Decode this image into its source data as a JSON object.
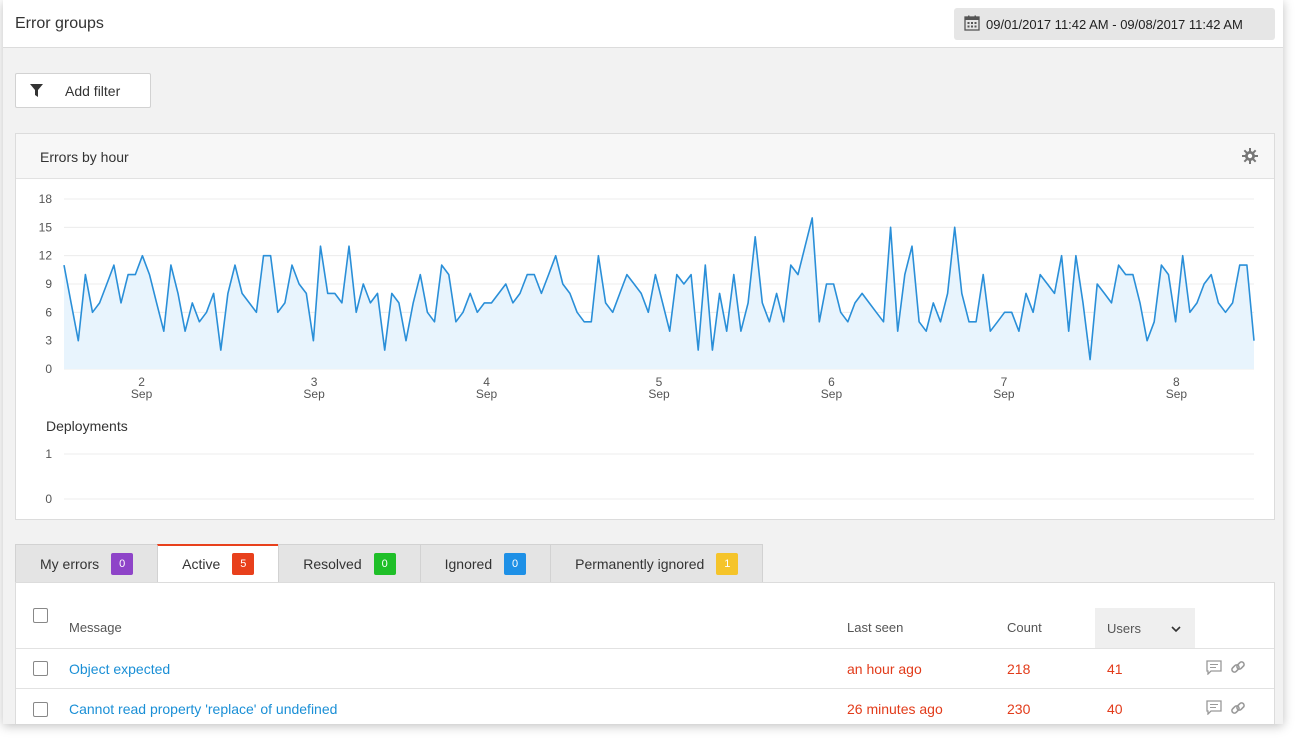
{
  "header": {
    "title": "Error groups",
    "date_range": "09/01/2017 11:42 AM - 09/08/2017 11:42 AM",
    "calendar_icon": "calendar-icon"
  },
  "filter": {
    "label": "Add filter",
    "icon": "filter-icon"
  },
  "chart_panel": {
    "title": "Errors by hour",
    "settings_icon": "gear-icon",
    "deployments_label": "Deployments",
    "deployments_ticks": [
      "1",
      "0"
    ]
  },
  "chart_data": {
    "type": "area",
    "title": "Errors by hour",
    "ylim": [
      0,
      18
    ],
    "yticks": [
      "0",
      "3",
      "6",
      "9",
      "12",
      "15",
      "18"
    ],
    "xticks": [
      {
        "day": "2",
        "month": "Sep"
      },
      {
        "day": "3",
        "month": "Sep"
      },
      {
        "day": "4",
        "month": "Sep"
      },
      {
        "day": "5",
        "month": "Sep"
      },
      {
        "day": "6",
        "month": "Sep"
      },
      {
        "day": "7",
        "month": "Sep"
      },
      {
        "day": "8",
        "month": "Sep"
      }
    ],
    "x_start_day": 1.55,
    "x_end_day": 8.45,
    "color": "#2a8fd8",
    "fill": "#e8f4fd",
    "values": [
      11,
      7,
      3,
      10,
      6,
      7,
      9,
      11,
      7,
      10,
      10,
      12,
      10,
      7,
      4,
      11,
      8,
      4,
      7,
      5,
      6,
      8,
      2,
      8,
      11,
      8,
      7,
      6,
      12,
      12,
      6,
      7,
      11,
      9,
      8,
      3,
      13,
      8,
      8,
      7,
      13,
      6,
      9,
      7,
      8,
      2,
      8,
      7,
      3,
      7,
      10,
      6,
      5,
      11,
      10,
      5,
      6,
      8,
      6,
      7,
      7,
      8,
      9,
      7,
      8,
      10,
      10,
      8,
      10,
      12,
      9,
      8,
      6,
      5,
      5,
      12,
      7,
      6,
      8,
      10,
      9,
      8,
      6,
      10,
      7,
      4,
      10,
      9,
      10,
      2,
      11,
      2,
      8,
      4,
      10,
      4,
      7,
      14,
      7,
      5,
      8,
      5,
      11,
      10,
      13,
      16,
      5,
      9,
      9,
      6,
      5,
      7,
      8,
      7,
      6,
      5,
      15,
      4,
      10,
      13,
      5,
      4,
      7,
      5,
      8,
      15,
      8,
      5,
      5,
      10,
      4,
      5,
      6,
      6,
      4,
      8,
      6,
      10,
      9,
      8,
      12,
      4,
      12,
      7,
      1,
      9,
      8,
      7,
      11,
      10,
      10,
      7,
      3,
      5,
      11,
      10,
      5,
      12,
      6,
      7,
      9,
      10,
      7,
      6,
      7,
      11,
      11,
      3
    ]
  },
  "tabs": [
    {
      "label": "My errors",
      "count": "0",
      "color": "#8e44c8"
    },
    {
      "label": "Active",
      "count": "5",
      "color": "#e8401c"
    },
    {
      "label": "Resolved",
      "count": "0",
      "color": "#1fbf28"
    },
    {
      "label": "Ignored",
      "count": "0",
      "color": "#1e90e6"
    },
    {
      "label": "Permanently ignored",
      "count": "1",
      "color": "#f5c42a"
    }
  ],
  "table": {
    "columns": {
      "message": "Message",
      "last_seen": "Last seen",
      "count": "Count",
      "users": "Users"
    },
    "rows": [
      {
        "message": "Object expected",
        "last_seen": "an hour ago",
        "count": "218",
        "users": "41"
      },
      {
        "message": "Cannot read property 'replace' of undefined",
        "last_seen": "26 minutes ago",
        "count": "230",
        "users": "40"
      }
    ]
  }
}
